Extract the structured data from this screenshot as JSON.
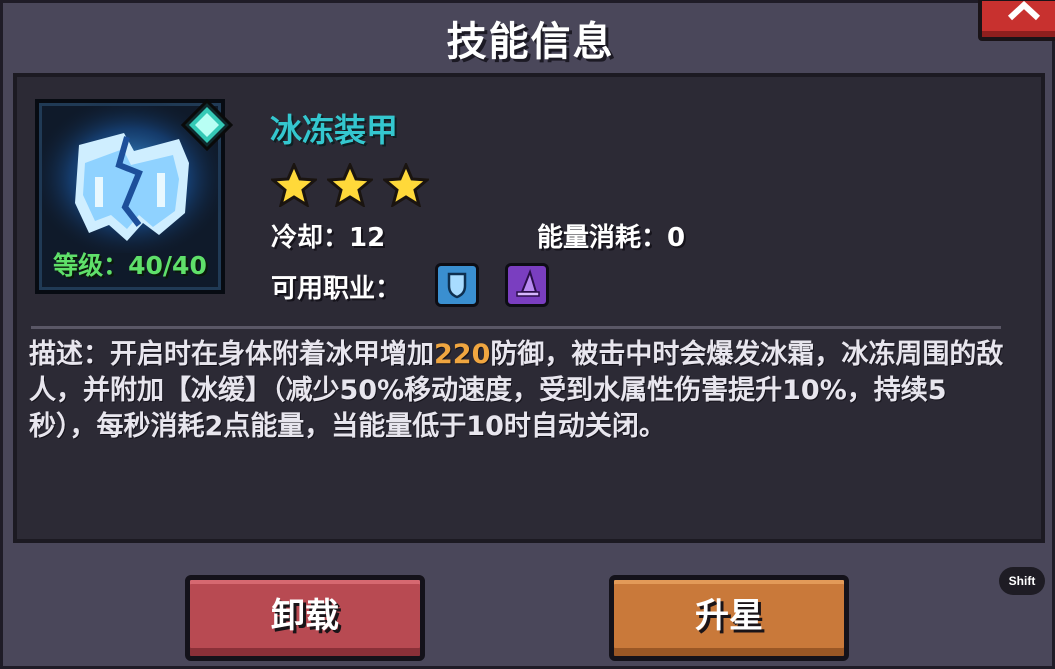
{
  "dialog": {
    "title": "技能信息",
    "close_icon": "close-chevron-icon"
  },
  "skill": {
    "name": "冰冻装甲",
    "icon": "frozen-armor-icon",
    "level_text": "等级：40/40",
    "star_count": 3,
    "stars_max": 3,
    "cooldown_label": "冷却：",
    "cooldown_value": "12",
    "energy_label": "能量消耗：",
    "energy_value": "0",
    "classes_label": "可用职业：",
    "classes": [
      {
        "icon": "knight-shield-icon",
        "color": "#3a8fd0"
      },
      {
        "icon": "wizard-hat-icon",
        "color": "#7a3ec0"
      }
    ]
  },
  "description": {
    "prefix": "描述：开启时在身体附着冰甲增加",
    "highlight": "220",
    "suffix": "防御，被击中时会爆发冰霜，冰冻周围的敌人，并附加【冰缓】（减少50%移动速度，受到水属性伤害提升10%，持续5秒），每秒消耗2点能量，当能量低于10时自动关闭。",
    "highlight_color": "#f0a640"
  },
  "buttons": {
    "unload_label": "卸载",
    "upgrade_label": "升星"
  },
  "shortcut_badge": "Shift"
}
